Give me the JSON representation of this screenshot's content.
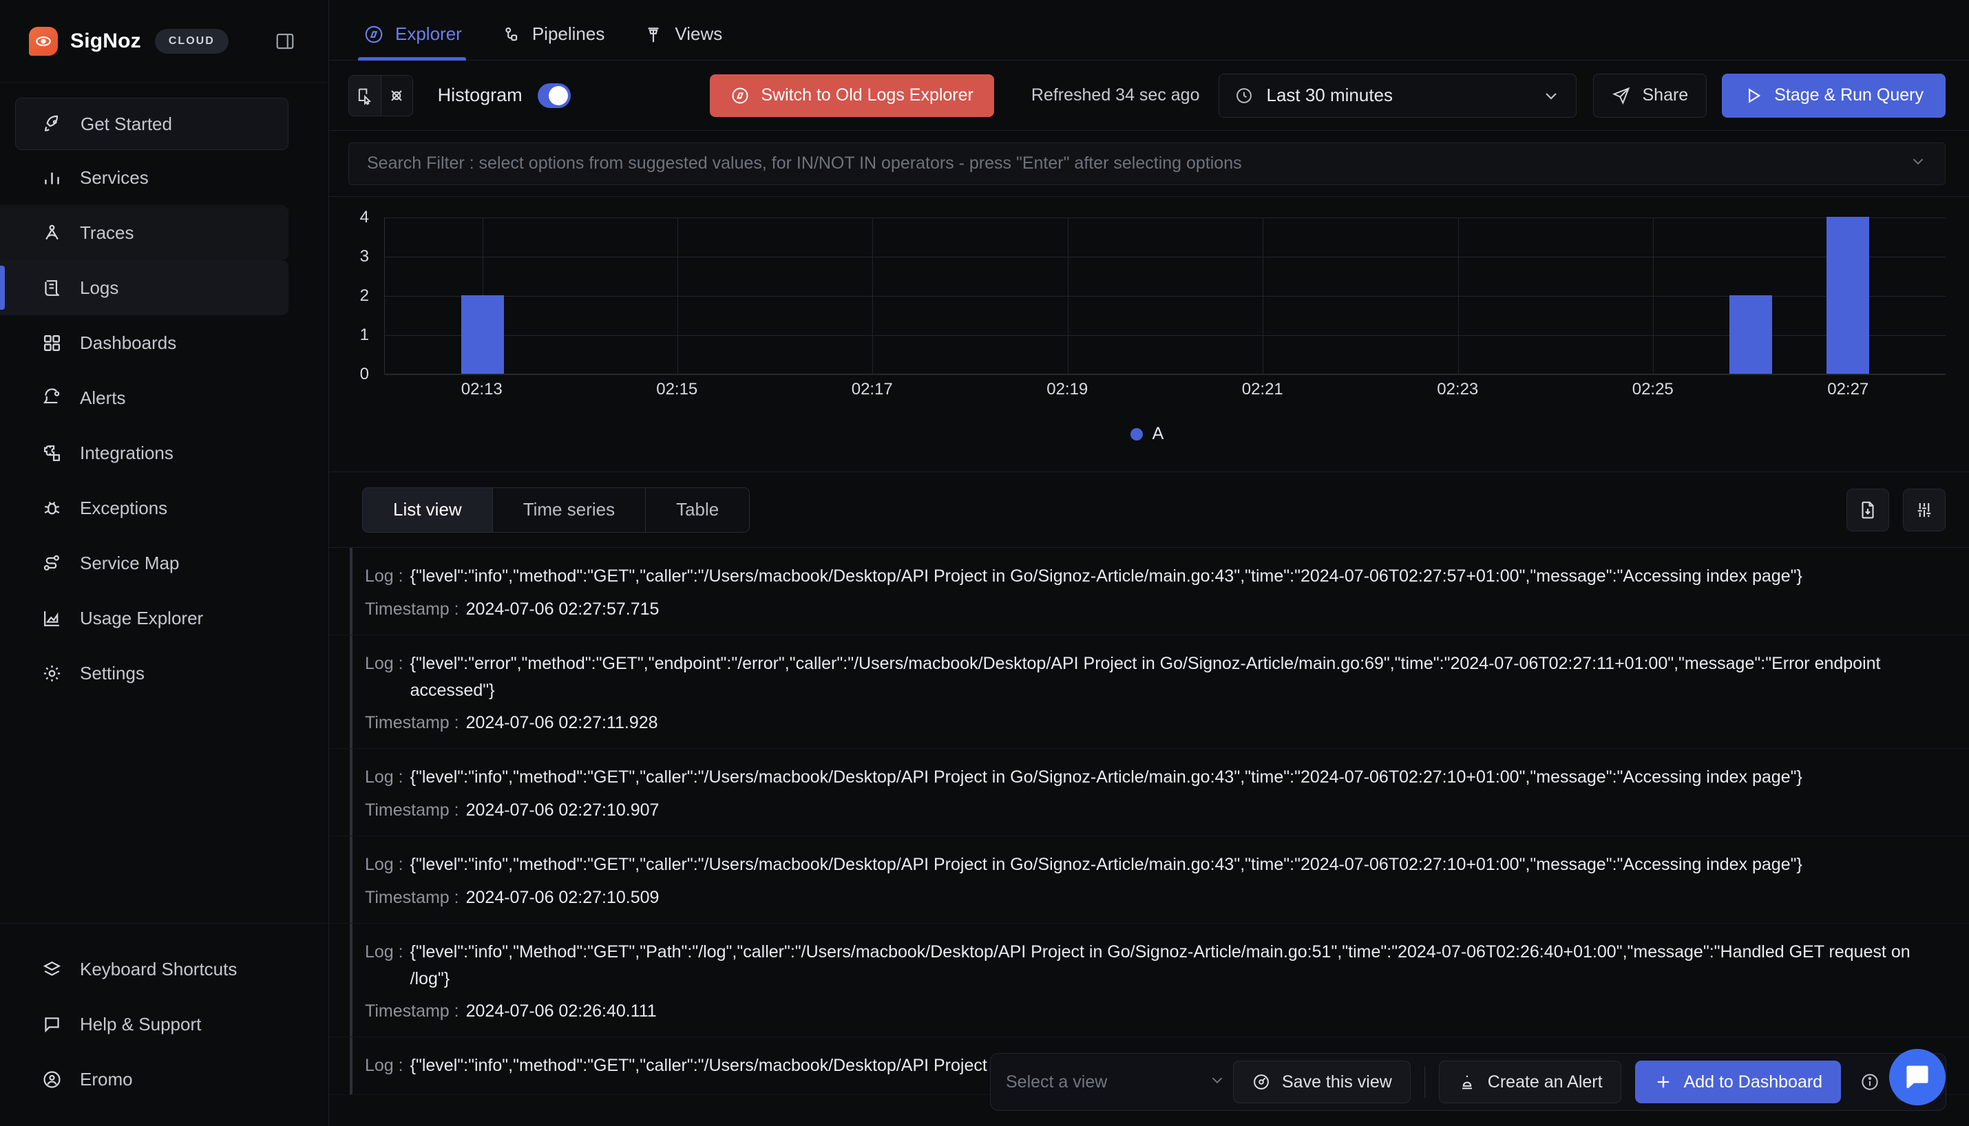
{
  "brand": {
    "name": "SigNoz",
    "chip": "CLOUD"
  },
  "sidebar": {
    "items": [
      {
        "label": "Get Started",
        "icon": "rocket-icon",
        "state": "boxed"
      },
      {
        "label": "Services",
        "icon": "bar-chart-icon",
        "state": "normal"
      },
      {
        "label": "Traces",
        "icon": "traces-icon",
        "state": "hl"
      },
      {
        "label": "Logs",
        "icon": "logs-icon",
        "state": "active"
      },
      {
        "label": "Dashboards",
        "icon": "grid-icon",
        "state": "normal"
      },
      {
        "label": "Alerts",
        "icon": "bell-icon",
        "state": "normal"
      },
      {
        "label": "Integrations",
        "icon": "puzzle-icon",
        "state": "normal"
      },
      {
        "label": "Exceptions",
        "icon": "bug-icon",
        "state": "normal"
      },
      {
        "label": "Service Map",
        "icon": "service-map-icon",
        "state": "normal"
      },
      {
        "label": "Usage Explorer",
        "icon": "usage-icon",
        "state": "normal"
      },
      {
        "label": "Settings",
        "icon": "gear-icon",
        "state": "normal"
      }
    ],
    "bottom_items": [
      {
        "label": "Keyboard Shortcuts",
        "icon": "layers-icon"
      },
      {
        "label": "Help & Support",
        "icon": "chat-icon"
      },
      {
        "label": "Eromo",
        "icon": "user-circle-icon"
      }
    ]
  },
  "tabs": [
    {
      "label": "Explorer",
      "icon": "compass-icon",
      "active": true
    },
    {
      "label": "Pipelines",
      "icon": "pipelines-icon",
      "active": false
    },
    {
      "label": "Views",
      "icon": "views-icon",
      "active": false
    }
  ],
  "toolbar": {
    "histogram_label": "Histogram",
    "histogram_on": true,
    "switch_old_label": "Switch to Old Logs Explorer",
    "refreshed_label": "Refreshed 34 sec ago",
    "time_range": "Last 30 minutes",
    "share_label": "Share",
    "run_label": "Stage & Run Query"
  },
  "search": {
    "placeholder": "Search Filter : select options from suggested values, for IN/NOT IN operators - press \"Enter\" after selecting options",
    "value": ""
  },
  "chart_data": {
    "type": "bar",
    "title": "",
    "xlabel": "",
    "ylabel": "",
    "ylim": [
      0,
      4
    ],
    "yticks": [
      0,
      1,
      2,
      3,
      4
    ],
    "xticks": [
      "02:13",
      "02:15",
      "02:17",
      "02:19",
      "02:21",
      "02:23",
      "02:25",
      "02:27"
    ],
    "grid": true,
    "legend": [
      "A"
    ],
    "legend_position": "bottom",
    "categories": [
      "02:13",
      "02:26",
      "02:27"
    ],
    "series": [
      {
        "name": "A",
        "color": "#4a62d8",
        "values": [
          2,
          2,
          4
        ]
      }
    ],
    "bars": [
      {
        "x": "02:13",
        "value": 2
      },
      {
        "x": "02:26",
        "value": 2
      },
      {
        "x": "02:27",
        "value": 4
      }
    ]
  },
  "view_tabs": [
    {
      "label": "List view",
      "active": true
    },
    {
      "label": "Time series",
      "active": false
    },
    {
      "label": "Table",
      "active": false
    }
  ],
  "view_tools": [
    {
      "name": "download-icon"
    },
    {
      "name": "sliders-icon"
    }
  ],
  "logs": {
    "log_key": "Log :",
    "timestamp_key": "Timestamp :",
    "rows": [
      {
        "log": "{\"level\":\"info\",\"method\":\"GET\",\"caller\":\"/Users/macbook/Desktop/API Project in Go/Signoz-Article/main.go:43\",\"time\":\"2024-07-06T02:27:57+01:00\",\"message\":\"Accessing index page\"}",
        "timestamp": "2024-07-06 02:27:57.715"
      },
      {
        "log": "{\"level\":\"error\",\"method\":\"GET\",\"endpoint\":\"/error\",\"caller\":\"/Users/macbook/Desktop/API Project in Go/Signoz-Article/main.go:69\",\"time\":\"2024-07-06T02:27:11+01:00\",\"message\":\"Error endpoint accessed\"}",
        "timestamp": "2024-07-06 02:27:11.928"
      },
      {
        "log": "{\"level\":\"info\",\"method\":\"GET\",\"caller\":\"/Users/macbook/Desktop/API Project in Go/Signoz-Article/main.go:43\",\"time\":\"2024-07-06T02:27:10+01:00\",\"message\":\"Accessing index page\"}",
        "timestamp": "2024-07-06 02:27:10.907"
      },
      {
        "log": "{\"level\":\"info\",\"method\":\"GET\",\"caller\":\"/Users/macbook/Desktop/API Project in Go/Signoz-Article/main.go:43\",\"time\":\"2024-07-06T02:27:10+01:00\",\"message\":\"Accessing index page\"}",
        "timestamp": "2024-07-06 02:27:10.509"
      },
      {
        "log": "{\"level\":\"info\",\"Method\":\"GET\",\"Path\":\"/log\",\"caller\":\"/Users/macbook/Desktop/API Project in Go/Signoz-Article/main.go:51\",\"time\":\"2024-07-06T02:26:40+01:00\",\"message\":\"Handled GET request on /log\"}",
        "timestamp": "2024-07-06 02:26:40.111"
      },
      {
        "log": "{\"level\":\"info\",\"method\":\"GET\",\"caller\":\"/Users/macbook/Desktop/API Project in Go/Signoz-Article/main.go:43\",\"time\":\"2024-07-06T02:26:17+01:00\",\"message\":\"Accessing index page\"}",
        "timestamp": ""
      }
    ]
  },
  "floatbar": {
    "select_placeholder": "Select a view",
    "save_label": "Save this view",
    "alert_label": "Create an Alert",
    "dashboard_label": "Add to Dashboard"
  },
  "colors": {
    "accent": "#4a62d8",
    "danger": "#d4554c",
    "brand": "#e4542f"
  }
}
